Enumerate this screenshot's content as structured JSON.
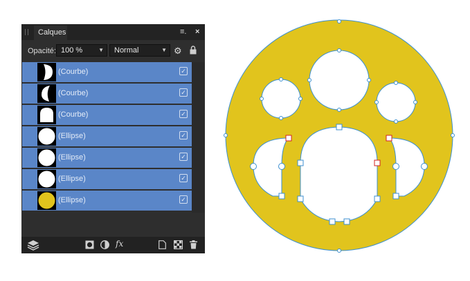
{
  "panel": {
    "tab_label": "Calques",
    "menu_icon": "≡.",
    "close_icon": "×",
    "opacity_label": "Opacité:",
    "opacity_value": "100 %",
    "blend_mode": "Normal"
  },
  "layers": [
    {
      "name": "(Courbe)",
      "thumb": "curve-right"
    },
    {
      "name": "(Courbe)",
      "thumb": "curve-left"
    },
    {
      "name": "(Courbe)",
      "thumb": "curve-arch"
    },
    {
      "name": "(Ellipse)",
      "thumb": "ellipse-white"
    },
    {
      "name": "(Ellipse)",
      "thumb": "ellipse-white"
    },
    {
      "name": "(Ellipse)",
      "thumb": "ellipse-white"
    },
    {
      "name": "(Ellipse)",
      "thumb": "ellipse-yellow"
    }
  ],
  "footer": {
    "fx_label": "fx"
  },
  "colors": {
    "layer_row": "#5a86c8",
    "yellow_fill": "#e1c41d",
    "selection_blue": "#3c8fd0",
    "handle_red": "#d22020"
  },
  "canvas": {
    "shape_names": [
      "outer-ellipse",
      "top-circle",
      "left-circle",
      "right-circle",
      "center-arch",
      "left-curve",
      "right-curve"
    ]
  }
}
